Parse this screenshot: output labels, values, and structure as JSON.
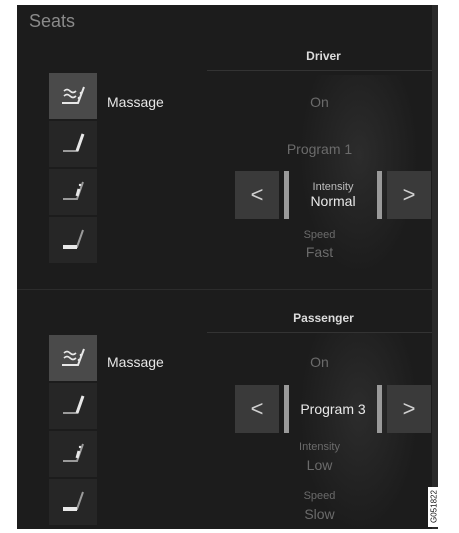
{
  "title": "Seats",
  "driver": {
    "header": "Driver",
    "massage_label": "Massage",
    "massage_state": "On",
    "program": "Program 1",
    "intensity_label": "Intensity",
    "intensity_value": "Normal",
    "speed_label": "Speed",
    "speed_value": "Fast",
    "icons": [
      "seat-massage-icon",
      "seat-backrest-icon",
      "seat-lumbar-icon",
      "seat-cushion-icon"
    ]
  },
  "passenger": {
    "header": "Passenger",
    "massage_label": "Massage",
    "massage_state": "On",
    "program": "Program 3",
    "intensity_label": "Intensity",
    "intensity_value": "Low",
    "speed_label": "Speed",
    "speed_value": "Slow",
    "icons": [
      "seat-massage-icon",
      "seat-backrest-icon",
      "seat-lumbar-icon",
      "seat-cushion-icon"
    ]
  },
  "arrows": {
    "left": "<",
    "right": ">"
  },
  "image_code": "G051822",
  "colors": {
    "background": "#1c1c1c",
    "button": "#3a3a3a",
    "active_icon": "#4a4a4a",
    "text": "#e6e6e6",
    "dim_text": "#6b6b6b"
  }
}
